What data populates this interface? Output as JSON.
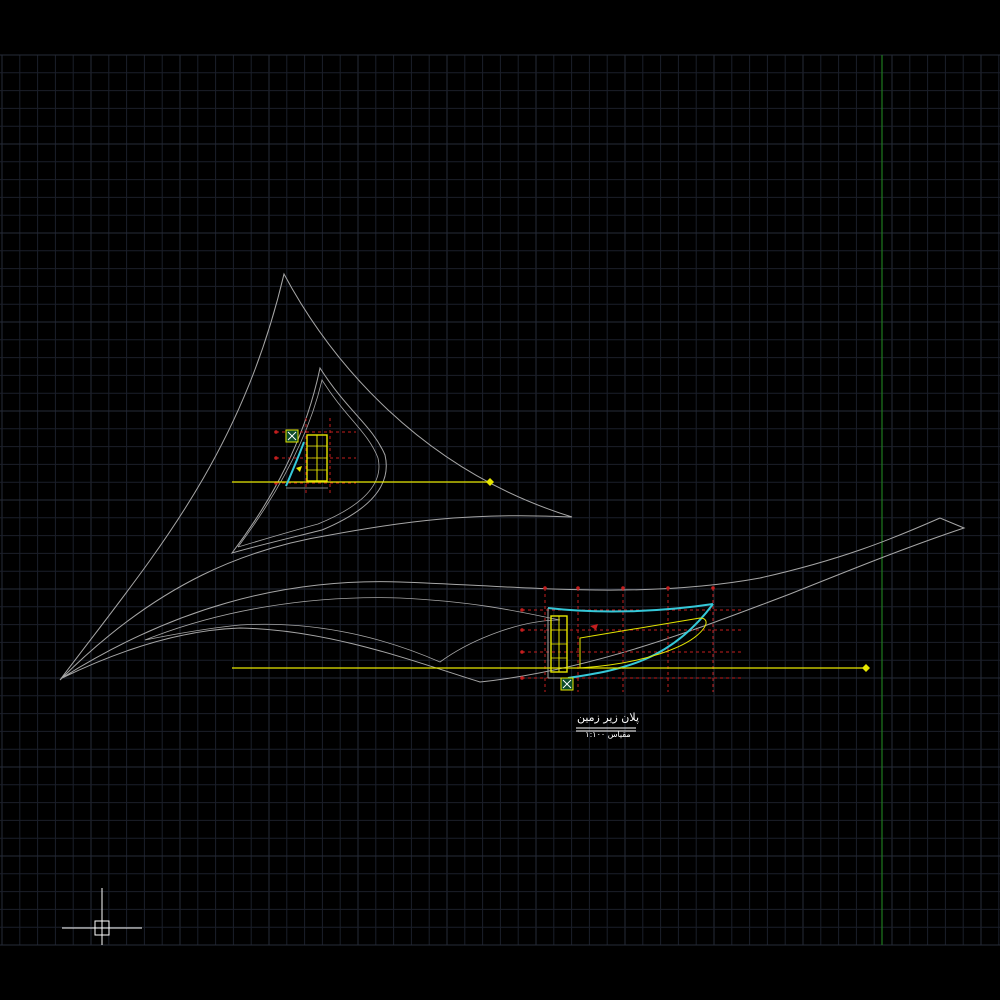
{
  "drawing": {
    "title": "پلان زیر زمین",
    "scale": "مقیاس ۱:۱۰۰"
  },
  "colors": {
    "background": "#000000",
    "grid_minor": "#1b1f2a",
    "grid_major": "#262b38",
    "outline": "#a6a6a6",
    "yellow": "#e6e600",
    "cyan": "#35c8d8",
    "red": "#c41e1e",
    "green_axis": "#1f7a1f",
    "crosshair": "#ffffff"
  },
  "icons": {
    "ucs": "ucs-crosshair-icon"
  }
}
